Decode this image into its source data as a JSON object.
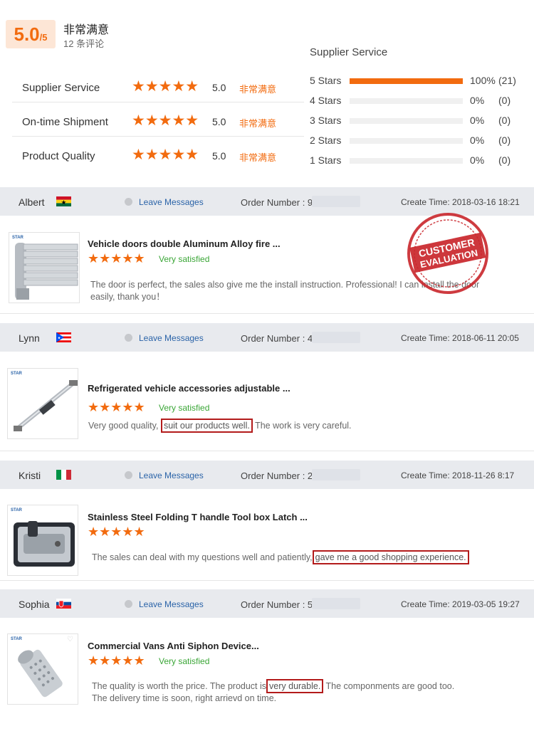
{
  "summary": {
    "score": "5.0",
    "score_max": "/5",
    "satisfaction": "非常满意",
    "review_count": "12 条评论"
  },
  "ratings": [
    {
      "label": "Supplier Service",
      "stars": "★★★★★",
      "value": "5.0",
      "text": "非常满意"
    },
    {
      "label": "On-time Shipment",
      "stars": "★★★★★",
      "value": "5.0",
      "text": "非常满意"
    },
    {
      "label": "Product Quality",
      "stars": "★★★★★",
      "value": "5.0",
      "text": "非常满意"
    }
  ],
  "distribution": {
    "title": "Supplier Service",
    "rows": [
      {
        "label": "5  Stars",
        "fraction": 1.0,
        "pct": "100%",
        "count": "(21)"
      },
      {
        "label": "4  Stars",
        "fraction": 0.0,
        "pct": "0%",
        "count": "(0)"
      },
      {
        "label": "3  Stars",
        "fraction": 0.0,
        "pct": "0%",
        "count": "(0)"
      },
      {
        "label": "2  Stars",
        "fraction": 0.0,
        "pct": "0%",
        "count": "(0)"
      },
      {
        "label": "1  Stars",
        "fraction": 0.0,
        "pct": "0%",
        "count": "(0)"
      }
    ]
  },
  "reviews": [
    {
      "name": "Albert",
      "leave_messages": "Leave Messages",
      "order_label": "Order Number : 9",
      "create_time": "Create Time: 2018-03-16 18:21",
      "product_title": "Vehicle doors double Aluminum Alloy fire ...",
      "stars": "★★★★★",
      "satisfied": "Very satisfied",
      "text_1": "The door is perfect, the sales also give me the install instruction. Professional! I can install the door",
      "text_2": "easily, thank you！",
      "thumb_brand": "STAR"
    },
    {
      "name": "Lynn",
      "leave_messages": "Leave Messages",
      "order_label": "Order Number : 4",
      "create_time": "Create Time: 2018-06-11 20:05",
      "product_title": "Refrigerated vehicle accessories adjustable ...",
      "stars": "★★★★★",
      "satisfied": "Very satisfied",
      "text_pre": "Very good quality,",
      "text_hl": "suit our products well.",
      "text_post": "The work is very careful.",
      "thumb_brand": "STAR"
    },
    {
      "name": "Kristi",
      "leave_messages": "Leave Messages",
      "order_label": "Order Number : 2",
      "create_time": "Create Time: 2018-11-26 8:17",
      "product_title": "Stainless Steel Folding T handle Tool box Latch ...",
      "stars": "★★★★★",
      "text_pre": "The sales can deal with my questions well and patiently,",
      "text_hl": "gave me a good shopping experience.",
      "thumb_brand": "STAR"
    },
    {
      "name": "Sophia",
      "leave_messages": "Leave Messages",
      "order_label": "Order Number : 5",
      "create_time": "Create Time: 2019-03-05 19:27",
      "product_title": "Commercial Vans Anti Siphon Device...",
      "stars": "★★★★★",
      "satisfied": "Very satisfied",
      "text_pre": "The quality is worth the price. The product is",
      "text_hl": "very durable.",
      "text_post": "The componments are good too.",
      "text_2": "The delivery time is soon, right arrievd on time.",
      "thumb_brand": "STAR"
    }
  ],
  "stamp": {
    "line1": "CUSTOMER",
    "line2": "EVALUATION"
  },
  "colors": {
    "accent": "#f26b0f",
    "satisfied": "#3aa636",
    "link": "#2a63a8",
    "highlight_border": "#b31b1b"
  }
}
